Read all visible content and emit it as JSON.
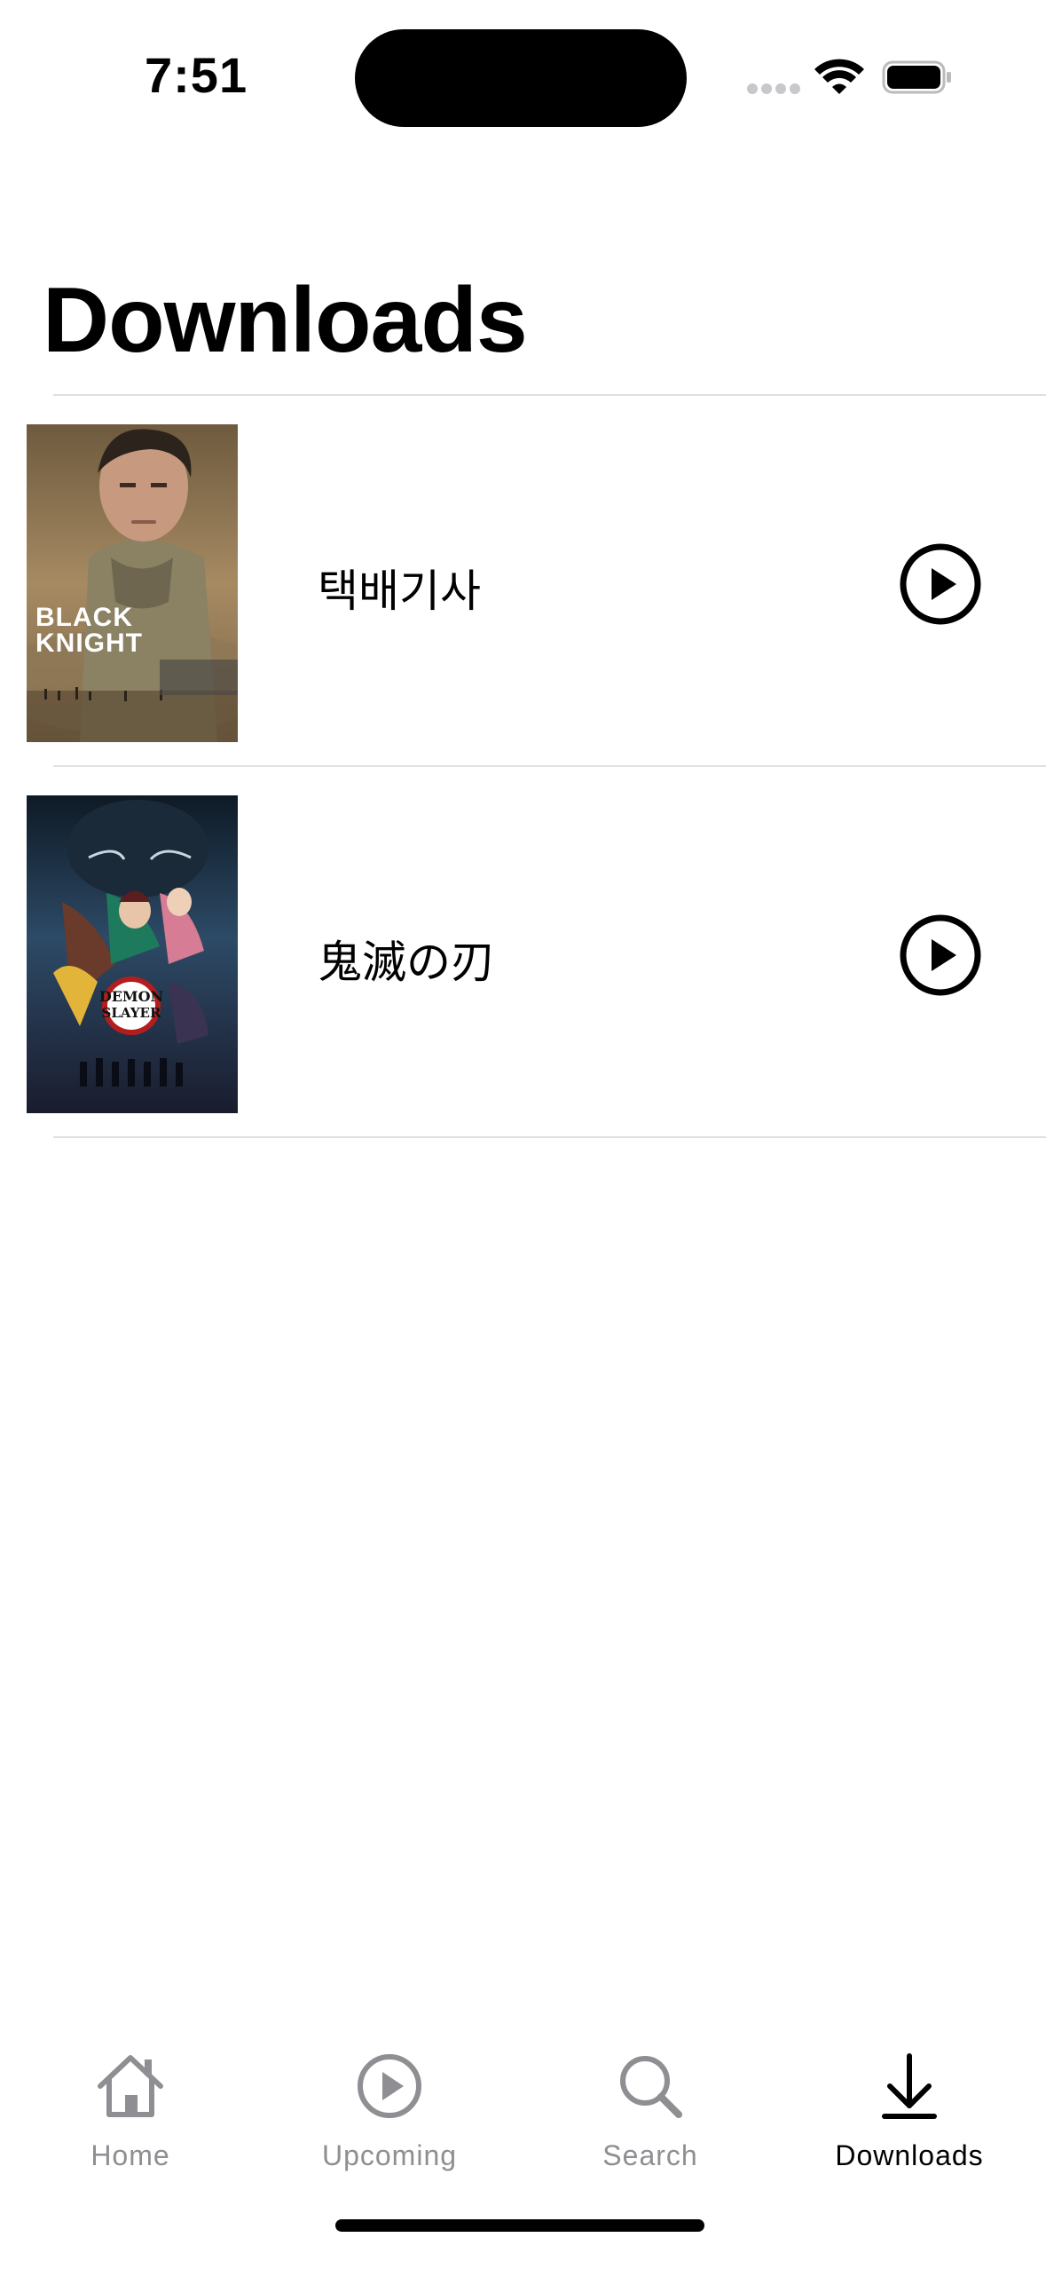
{
  "status_bar": {
    "time": "7:51"
  },
  "page": {
    "title": "Downloads"
  },
  "downloads": [
    {
      "title": "택배기사",
      "poster_text_line1": "BLACK",
      "poster_text_line2": "KNIGHT",
      "play_icon": "play-circle-icon"
    },
    {
      "title": "鬼滅の刃",
      "poster_text_line1": "DEMON",
      "poster_text_line2": "SLAYER",
      "play_icon": "play-circle-icon"
    }
  ],
  "tab_bar": {
    "tabs": [
      {
        "label": "Home",
        "icon": "house-icon",
        "active": false
      },
      {
        "label": "Upcoming",
        "icon": "play-circle-icon",
        "active": false
      },
      {
        "label": "Search",
        "icon": "magnifying-glass-icon",
        "active": false
      },
      {
        "label": "Downloads",
        "icon": "download-arrow-icon",
        "active": true
      }
    ]
  },
  "colors": {
    "inactive_tab": "#8e8e93",
    "active_tab": "#000000",
    "separator": "#e0e0e3"
  }
}
